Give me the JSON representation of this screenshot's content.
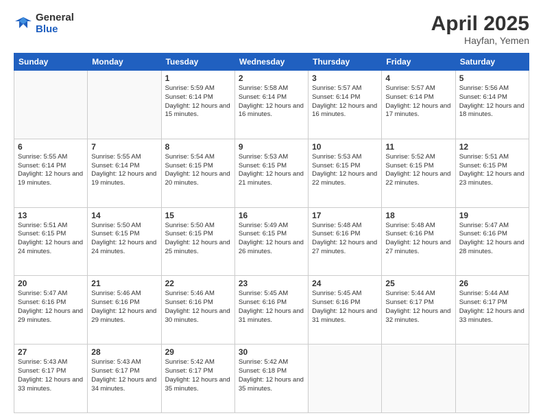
{
  "header": {
    "logo_general": "General",
    "logo_blue": "Blue",
    "title": "April 2025",
    "location": "Hayfan, Yemen"
  },
  "weekdays": [
    "Sunday",
    "Monday",
    "Tuesday",
    "Wednesday",
    "Thursday",
    "Friday",
    "Saturday"
  ],
  "weeks": [
    [
      {
        "day": "",
        "sunrise": "",
        "sunset": "",
        "daylight": ""
      },
      {
        "day": "",
        "sunrise": "",
        "sunset": "",
        "daylight": ""
      },
      {
        "day": "1",
        "sunrise": "Sunrise: 5:59 AM",
        "sunset": "Sunset: 6:14 PM",
        "daylight": "Daylight: 12 hours and 15 minutes."
      },
      {
        "day": "2",
        "sunrise": "Sunrise: 5:58 AM",
        "sunset": "Sunset: 6:14 PM",
        "daylight": "Daylight: 12 hours and 16 minutes."
      },
      {
        "day": "3",
        "sunrise": "Sunrise: 5:57 AM",
        "sunset": "Sunset: 6:14 PM",
        "daylight": "Daylight: 12 hours and 16 minutes."
      },
      {
        "day": "4",
        "sunrise": "Sunrise: 5:57 AM",
        "sunset": "Sunset: 6:14 PM",
        "daylight": "Daylight: 12 hours and 17 minutes."
      },
      {
        "day": "5",
        "sunrise": "Sunrise: 5:56 AM",
        "sunset": "Sunset: 6:14 PM",
        "daylight": "Daylight: 12 hours and 18 minutes."
      }
    ],
    [
      {
        "day": "6",
        "sunrise": "Sunrise: 5:55 AM",
        "sunset": "Sunset: 6:14 PM",
        "daylight": "Daylight: 12 hours and 19 minutes."
      },
      {
        "day": "7",
        "sunrise": "Sunrise: 5:55 AM",
        "sunset": "Sunset: 6:14 PM",
        "daylight": "Daylight: 12 hours and 19 minutes."
      },
      {
        "day": "8",
        "sunrise": "Sunrise: 5:54 AM",
        "sunset": "Sunset: 6:15 PM",
        "daylight": "Daylight: 12 hours and 20 minutes."
      },
      {
        "day": "9",
        "sunrise": "Sunrise: 5:53 AM",
        "sunset": "Sunset: 6:15 PM",
        "daylight": "Daylight: 12 hours and 21 minutes."
      },
      {
        "day": "10",
        "sunrise": "Sunrise: 5:53 AM",
        "sunset": "Sunset: 6:15 PM",
        "daylight": "Daylight: 12 hours and 22 minutes."
      },
      {
        "day": "11",
        "sunrise": "Sunrise: 5:52 AM",
        "sunset": "Sunset: 6:15 PM",
        "daylight": "Daylight: 12 hours and 22 minutes."
      },
      {
        "day": "12",
        "sunrise": "Sunrise: 5:51 AM",
        "sunset": "Sunset: 6:15 PM",
        "daylight": "Daylight: 12 hours and 23 minutes."
      }
    ],
    [
      {
        "day": "13",
        "sunrise": "Sunrise: 5:51 AM",
        "sunset": "Sunset: 6:15 PM",
        "daylight": "Daylight: 12 hours and 24 minutes."
      },
      {
        "day": "14",
        "sunrise": "Sunrise: 5:50 AM",
        "sunset": "Sunset: 6:15 PM",
        "daylight": "Daylight: 12 hours and 24 minutes."
      },
      {
        "day": "15",
        "sunrise": "Sunrise: 5:50 AM",
        "sunset": "Sunset: 6:15 PM",
        "daylight": "Daylight: 12 hours and 25 minutes."
      },
      {
        "day": "16",
        "sunrise": "Sunrise: 5:49 AM",
        "sunset": "Sunset: 6:15 PM",
        "daylight": "Daylight: 12 hours and 26 minutes."
      },
      {
        "day": "17",
        "sunrise": "Sunrise: 5:48 AM",
        "sunset": "Sunset: 6:16 PM",
        "daylight": "Daylight: 12 hours and 27 minutes."
      },
      {
        "day": "18",
        "sunrise": "Sunrise: 5:48 AM",
        "sunset": "Sunset: 6:16 PM",
        "daylight": "Daylight: 12 hours and 27 minutes."
      },
      {
        "day": "19",
        "sunrise": "Sunrise: 5:47 AM",
        "sunset": "Sunset: 6:16 PM",
        "daylight": "Daylight: 12 hours and 28 minutes."
      }
    ],
    [
      {
        "day": "20",
        "sunrise": "Sunrise: 5:47 AM",
        "sunset": "Sunset: 6:16 PM",
        "daylight": "Daylight: 12 hours and 29 minutes."
      },
      {
        "day": "21",
        "sunrise": "Sunrise: 5:46 AM",
        "sunset": "Sunset: 6:16 PM",
        "daylight": "Daylight: 12 hours and 29 minutes."
      },
      {
        "day": "22",
        "sunrise": "Sunrise: 5:46 AM",
        "sunset": "Sunset: 6:16 PM",
        "daylight": "Daylight: 12 hours and 30 minutes."
      },
      {
        "day": "23",
        "sunrise": "Sunrise: 5:45 AM",
        "sunset": "Sunset: 6:16 PM",
        "daylight": "Daylight: 12 hours and 31 minutes."
      },
      {
        "day": "24",
        "sunrise": "Sunrise: 5:45 AM",
        "sunset": "Sunset: 6:16 PM",
        "daylight": "Daylight: 12 hours and 31 minutes."
      },
      {
        "day": "25",
        "sunrise": "Sunrise: 5:44 AM",
        "sunset": "Sunset: 6:17 PM",
        "daylight": "Daylight: 12 hours and 32 minutes."
      },
      {
        "day": "26",
        "sunrise": "Sunrise: 5:44 AM",
        "sunset": "Sunset: 6:17 PM",
        "daylight": "Daylight: 12 hours and 33 minutes."
      }
    ],
    [
      {
        "day": "27",
        "sunrise": "Sunrise: 5:43 AM",
        "sunset": "Sunset: 6:17 PM",
        "daylight": "Daylight: 12 hours and 33 minutes."
      },
      {
        "day": "28",
        "sunrise": "Sunrise: 5:43 AM",
        "sunset": "Sunset: 6:17 PM",
        "daylight": "Daylight: 12 hours and 34 minutes."
      },
      {
        "day": "29",
        "sunrise": "Sunrise: 5:42 AM",
        "sunset": "Sunset: 6:17 PM",
        "daylight": "Daylight: 12 hours and 35 minutes."
      },
      {
        "day": "30",
        "sunrise": "Sunrise: 5:42 AM",
        "sunset": "Sunset: 6:18 PM",
        "daylight": "Daylight: 12 hours and 35 minutes."
      },
      {
        "day": "",
        "sunrise": "",
        "sunset": "",
        "daylight": ""
      },
      {
        "day": "",
        "sunrise": "",
        "sunset": "",
        "daylight": ""
      },
      {
        "day": "",
        "sunrise": "",
        "sunset": "",
        "daylight": ""
      }
    ]
  ]
}
